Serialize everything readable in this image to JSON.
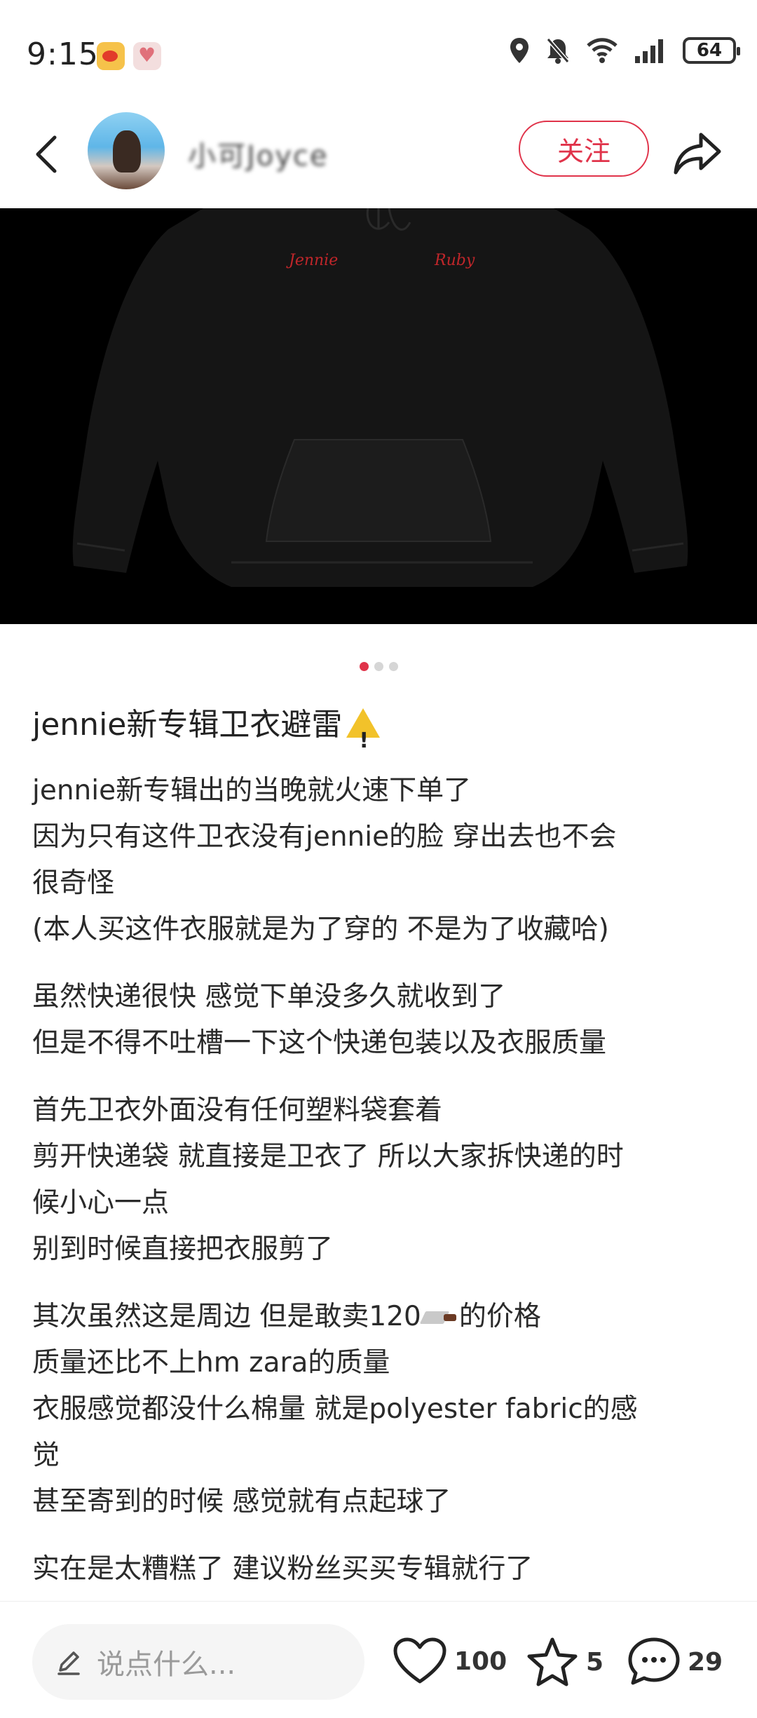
{
  "status_bar": {
    "time": "9:15",
    "battery": "64",
    "icons": [
      "weibo-app-icon",
      "heart-app-icon",
      "location-icon",
      "mute-bell-icon",
      "wifi-icon",
      "signal-icon",
      "battery-icon"
    ]
  },
  "header": {
    "username": "小可Joyce",
    "follow_label": "关注",
    "icons": [
      "back-arrow-icon",
      "share-icon"
    ]
  },
  "image": {
    "embroidery_left": "Jennie",
    "embroidery_right": "Ruby",
    "carousel_total": 3,
    "carousel_active": 1
  },
  "post": {
    "title": "jennie新专辑卫衣避雷",
    "paragraphs": [
      [
        "jennie新专辑出的当晚就火速下单了",
        "因为只有这件卫衣没有jennie的脸 穿出去也不会",
        "很奇怪",
        "(本人买这件衣服就是为了穿的 不是为了收藏哈)"
      ],
      [
        "虽然快递很快 感觉下单没多久就收到了",
        "但是不得不吐槽一下这个快递包装以及衣服质量"
      ],
      [
        "首先卫衣外面没有任何塑料袋套着",
        "剪开快递袋 就直接是卫衣了 所以大家拆快递的时",
        "候小心一点",
        "别到时候直接把衣服剪了"
      ],
      [
        "其次虽然这是周边 但是敢卖120",
        "质量还比不上hm zara的质量",
        "衣服感觉都没什么棉量 就是polyester fabric的感",
        "觉",
        "甚至寄到的时候 感觉就有点起球了"
      ],
      [
        "实在是太糟糕了 建议粉丝买买专辑就行了"
      ]
    ],
    "price_suffix": "的价格"
  },
  "bottom_bar": {
    "comment_placeholder": "说点什么...",
    "likes": "100",
    "collects": "5",
    "comments": "29"
  }
}
